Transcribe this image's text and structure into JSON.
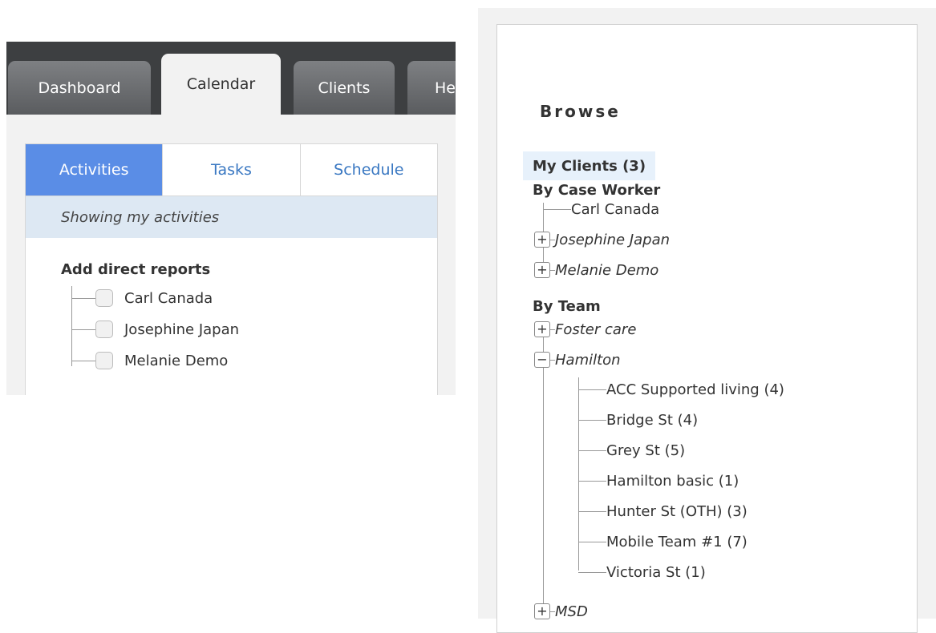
{
  "left": {
    "top_tabs": [
      {
        "label": "Dashboard",
        "active": false
      },
      {
        "label": "Calendar",
        "active": true
      },
      {
        "label": "Clients",
        "active": false
      },
      {
        "label": "He",
        "active": false
      }
    ],
    "sub_tabs": [
      {
        "label": "Activities",
        "active": true
      },
      {
        "label": "Tasks",
        "active": false
      },
      {
        "label": "Schedule",
        "active": false
      }
    ],
    "showing_text": "Showing my activities",
    "reports_title": "Add direct reports",
    "reports": [
      "Carl Canada",
      "Josephine Japan",
      "Melanie Demo"
    ]
  },
  "right": {
    "title": "Browse",
    "my_clients": "My Clients (3)",
    "by_case_worker": {
      "label": "By Case Worker",
      "items": [
        {
          "label": "Carl Canada",
          "expander": null
        },
        {
          "label": "Josephine Japan",
          "expander": "+"
        },
        {
          "label": "Melanie Demo",
          "expander": "+"
        }
      ]
    },
    "by_team": {
      "label": "By Team",
      "items": [
        {
          "label": "Foster care",
          "expander": "+"
        },
        {
          "label": "Hamilton",
          "expander": "−"
        },
        {
          "label": "MSD",
          "expander": "+"
        }
      ],
      "hamilton_children": [
        "ACC Supported living (4)",
        "Bridge St (4)",
        "Grey St (5)",
        "Hamilton basic (1)",
        "Hunter St (OTH) (3)",
        "Mobile Team #1 (7)",
        "Victoria St (1)"
      ]
    }
  }
}
